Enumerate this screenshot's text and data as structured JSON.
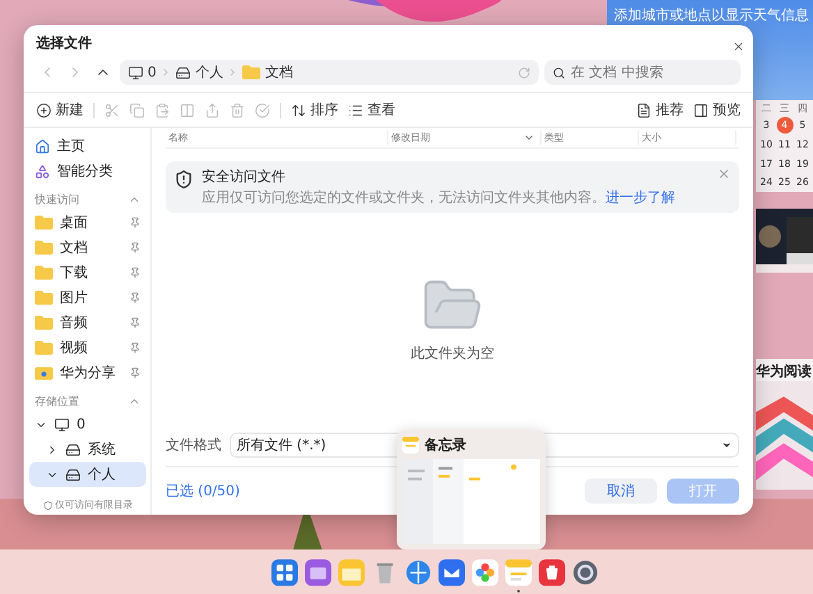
{
  "desktop": {
    "weather_hint": "添加城市或地点以显示天气信息",
    "calendar": {
      "weekdays": [
        "二",
        "三",
        "四"
      ],
      "days": [
        {
          "label": "3",
          "selected": false
        },
        {
          "label": "4",
          "selected": true
        },
        {
          "label": "5",
          "selected": false
        },
        {
          "label": "10",
          "selected": false
        },
        {
          "label": "11",
          "selected": false
        },
        {
          "label": "12",
          "selected": false
        },
        {
          "label": "17",
          "selected": false
        },
        {
          "label": "18",
          "selected": false
        },
        {
          "label": "19",
          "selected": false
        },
        {
          "label": "24",
          "selected": false
        },
        {
          "label": "25",
          "selected": false
        },
        {
          "label": "26",
          "selected": false
        }
      ]
    },
    "reading_widget": {
      "title": "华为阅读"
    }
  },
  "dialog": {
    "title": "选择文件",
    "nav": {
      "back_disabled": true,
      "forward_disabled": true,
      "breadcrumb": [
        {
          "label": "0",
          "kind": "computer"
        },
        {
          "label": "个人",
          "kind": "drive"
        },
        {
          "label": "文档",
          "kind": "folder"
        }
      ],
      "search": {
        "placeholder": "在 文档 中搜索"
      }
    },
    "toolbar": [
      {
        "kind": "new",
        "label": "新建",
        "disabled": false
      },
      {
        "kind": "cut",
        "disabled": true
      },
      {
        "kind": "copy",
        "disabled": true
      },
      {
        "kind": "paste",
        "disabled": true
      },
      {
        "kind": "rename",
        "disabled": true
      },
      {
        "kind": "share",
        "disabled": true
      },
      {
        "kind": "delete",
        "disabled": true
      },
      {
        "kind": "select",
        "disabled": true
      },
      {
        "kind": "sort",
        "label": "排序",
        "disabled": false
      },
      {
        "kind": "view",
        "label": "查看",
        "disabled": false
      }
    ],
    "toolbar_right": [
      {
        "kind": "recommend",
        "label": "推荐"
      },
      {
        "kind": "preview",
        "label": "预览"
      }
    ],
    "sidebar": {
      "nav": [
        {
          "kind": "home",
          "label": "主页",
          "selected": false
        },
        {
          "kind": "smart",
          "label": "智能分类",
          "selected": false
        }
      ],
      "quick_access": {
        "title": "快速访问",
        "expanded": true,
        "items": [
          {
            "kind": "folder",
            "label": "桌面",
            "pinned": true
          },
          {
            "kind": "folder",
            "label": "文档",
            "pinned": true
          },
          {
            "kind": "folder",
            "label": "下载",
            "pinned": true
          },
          {
            "kind": "folder",
            "label": "图片",
            "pinned": true
          },
          {
            "kind": "folder",
            "label": "音频",
            "pinned": true
          },
          {
            "kind": "folder",
            "label": "视频",
            "pinned": true
          },
          {
            "kind": "share",
            "label": "华为分享",
            "pinned": true
          }
        ]
      },
      "storage": {
        "title": "存储位置",
        "expanded": true,
        "tree": [
          {
            "kind": "computer",
            "label": "0",
            "expanded": true,
            "selected": false,
            "children": [
              {
                "kind": "drive",
                "label": "系统",
                "expanded": false,
                "selected": false
              },
              {
                "kind": "drive",
                "label": "个人",
                "expanded": true,
                "selected": true
              }
            ]
          }
        ]
      },
      "footer": "仅可访问有限目录"
    },
    "columns": [
      {
        "label": "名称",
        "sorted": false
      },
      {
        "label": "修改日期",
        "sorted": true
      },
      {
        "label": "类型",
        "sorted": false
      },
      {
        "label": "大小",
        "sorted": false
      }
    ],
    "banner": {
      "title": "安全访问文件",
      "text": "应用仅可访问您选定的文件或文件夹，无法访问文件夹其他内容。",
      "link": "进一步了解"
    },
    "empty_text": "此文件夹为空",
    "file_format": {
      "label": "文件格式",
      "value": "所有文件 (*.*)"
    },
    "selected_count": "已选 (0/50)",
    "buttons": [
      {
        "kind": "cancel",
        "label": "取消",
        "disabled": false
      },
      {
        "kind": "open",
        "label": "打开",
        "disabled": true
      }
    ]
  },
  "memo_preview": {
    "title": "备忘录"
  },
  "dock": {
    "items": [
      {
        "kind": "launcher",
        "running": false
      },
      {
        "kind": "files",
        "running": false
      },
      {
        "kind": "notes",
        "running": false
      },
      {
        "kind": "trash",
        "running": false
      },
      {
        "kind": "browser",
        "running": false
      },
      {
        "kind": "mail",
        "running": false
      },
      {
        "kind": "gallery",
        "running": false
      },
      {
        "kind": "memo",
        "running": true
      },
      {
        "kind": "store",
        "running": false
      },
      {
        "kind": "settings",
        "running": false
      }
    ]
  }
}
